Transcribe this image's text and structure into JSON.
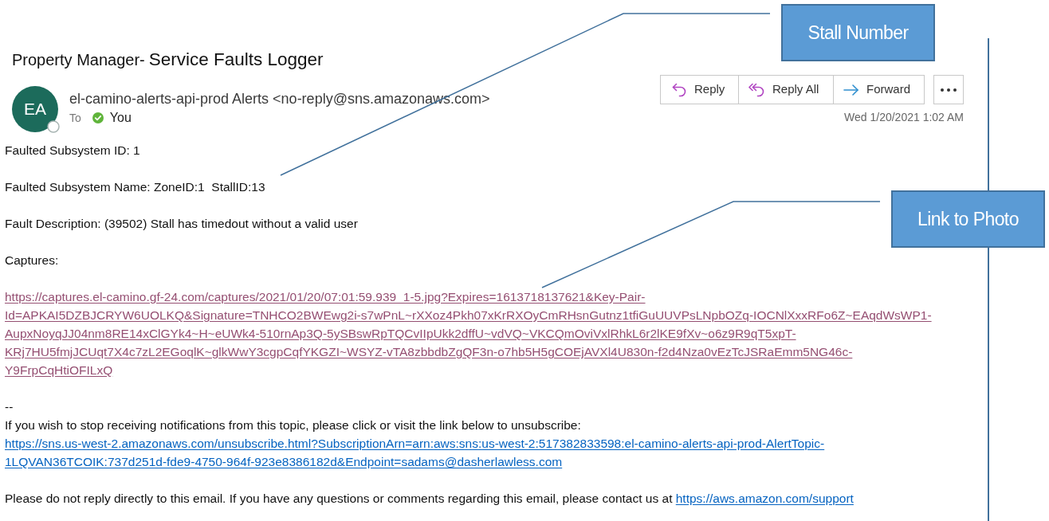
{
  "title": {
    "app": "Property Manager-",
    "page": "Service Faults Logger"
  },
  "message": {
    "avatar_initials": "EA",
    "sender": "el-camino-alerts-api-prod Alerts <no-reply@sns.amazonaws.com>",
    "to_label": "To",
    "recipient": "You",
    "date": "Wed 1/20/2021 1:02 AM"
  },
  "actions": [
    {
      "kind": "reply",
      "label": "Reply"
    },
    {
      "kind": "reply_all",
      "label": "Reply All"
    },
    {
      "kind": "forward",
      "label": "Forward"
    },
    {
      "kind": "more"
    }
  ],
  "body": [
    {
      "parts": [
        {
          "kind": "text",
          "text": "Faulted Subsystem ID: 1"
        }
      ]
    },
    {
      "parts": [
        {
          "kind": "text",
          "text": "Faulted Subsystem Name: ZoneID:1  StallID:13"
        }
      ]
    },
    {
      "parts": [
        {
          "kind": "text",
          "text": "Fault Description: (39502) Stall has timedout without a valid user"
        }
      ]
    },
    {
      "parts": [
        {
          "kind": "text",
          "text": "Captures:"
        }
      ]
    },
    {
      "parts": [
        {
          "kind": "link",
          "visited": true,
          "lines": [
            "https://captures.el-camino.gf-24.com/captures/2021/01/20/07:01:59.939_1-5.jpg?Expires=1613718137621&Key-Pair-",
            "Id=APKAI5DZBJCRYW6UOLKQ&Signature=TNHCO2BWEwg2i-s7wPnL~rXXoz4Pkh07xKrRXOyCmRHsnGutnz1tfiGuUUVPsLNpbOZq-IOCNlXxxRFo6Z~EAqdWsWP1-",
            "AupxNoyqJJ04nm8RE14xClGYk4~H~eUWk4-510rnAp3Q-5ySBswRpTQCvIIpUkk2dffU~vdVQ~VKCQmOviVxlRhkL6r2lKE9fXv~o6z9R9qT5xpT-",
            "KRj7HU5fmjJCUqt7X4c7zL2EGoqlK~glkWwY3cgpCqfYKGZI~WSYZ-vTA8zbbdbZgQF3n-o7hb5H5gCOEjAVXl4U830n-f2d4Nza0vEzTcJSRaEmm5NG46c-",
            "Y9FrpCqHtiOFILxQ"
          ]
        }
      ]
    },
    {
      "parts": [
        {
          "kind": "text",
          "text": "--"
        },
        {
          "kind": "text",
          "text": "If you wish to stop receiving notifications from this topic, please click or visit the link below to unsubscribe:"
        },
        {
          "kind": "link",
          "visited": false,
          "lines": [
            "https://sns.us-west-2.amazonaws.com/unsubscribe.html?SubscriptionArn=arn:aws:sns:us-west-2:517382833598:el-camino-alerts-api-prod-AlertTopic-",
            "1LQVAN36TCOIK:737d251d-fde9-4750-964f-923e8386182d&Endpoint=sadams@dasherlawless.com"
          ]
        }
      ]
    },
    {
      "parts": [
        {
          "kind": "text_with_link",
          "text": "Please do not reply directly to this email. If you have any questions or comments regarding this email, please contact us at",
          "link": "https://aws.amazon.com/support",
          "visited": false
        }
      ]
    }
  ],
  "callouts": [
    {
      "label": "Stall Number"
    },
    {
      "label": "Link to Photo"
    }
  ]
}
